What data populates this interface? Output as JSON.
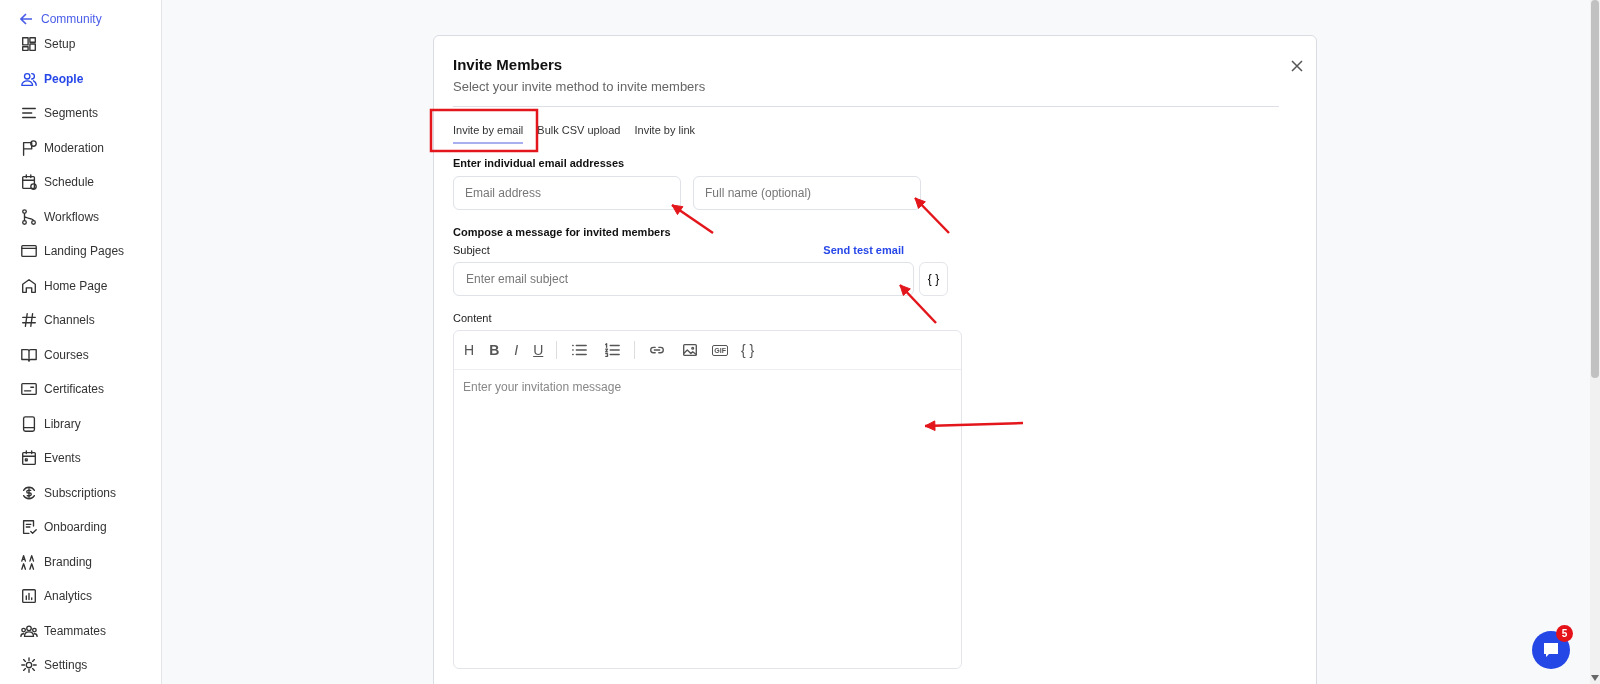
{
  "sidebar": {
    "back": {
      "label": "Community"
    },
    "items": [
      {
        "label": "Setup",
        "selected": false
      },
      {
        "label": "People",
        "selected": true
      },
      {
        "label": "Segments",
        "selected": false
      },
      {
        "label": "Moderation",
        "selected": false
      },
      {
        "label": "Schedule",
        "selected": false
      },
      {
        "label": "Workflows",
        "selected": false
      },
      {
        "label": "Landing Pages",
        "selected": false
      },
      {
        "label": "Home Page",
        "selected": false
      },
      {
        "label": "Channels",
        "selected": false
      },
      {
        "label": "Courses",
        "selected": false
      },
      {
        "label": "Certificates",
        "selected": false
      },
      {
        "label": "Library",
        "selected": false
      },
      {
        "label": "Events",
        "selected": false
      },
      {
        "label": "Subscriptions",
        "selected": false
      },
      {
        "label": "Onboarding",
        "selected": false
      },
      {
        "label": "Branding",
        "selected": false
      },
      {
        "label": "Analytics",
        "selected": false
      },
      {
        "label": "Teammates",
        "selected": false
      },
      {
        "label": "Settings",
        "selected": false
      }
    ]
  },
  "dialog": {
    "title": "Invite Members",
    "subtitle": "Select your invite method to invite members",
    "tabs": [
      {
        "label": "Invite by email",
        "selected": true
      },
      {
        "label": "Bulk CSV upload",
        "selected": false
      },
      {
        "label": "Invite by link",
        "selected": false
      }
    ],
    "email_section": {
      "heading": "Enter individual email addresses",
      "email": {
        "placeholder": "Email address"
      },
      "name": {
        "placeholder": "Full name (optional)"
      }
    },
    "compose_heading": "Compose a message for invited members",
    "subject": {
      "label": "Subject",
      "link": "Send test email",
      "placeholder": "Enter email subject",
      "variables_button": "{ }"
    },
    "content": {
      "label": "Content",
      "toolbar": [
        {
          "kind": "heading",
          "label": "H"
        },
        {
          "kind": "bold",
          "label": "B"
        },
        {
          "kind": "italic",
          "label": "I"
        },
        {
          "kind": "underline",
          "label": "U"
        },
        {
          "kind": "divider"
        },
        {
          "kind": "bullets"
        },
        {
          "kind": "numbers"
        },
        {
          "kind": "divider"
        },
        {
          "kind": "link"
        },
        {
          "kind": "image"
        },
        {
          "kind": "gif",
          "label": "GIF"
        },
        {
          "kind": "variables",
          "label": "{ }"
        }
      ],
      "placeholder": "Enter your invitation message"
    }
  },
  "chat": {
    "badge": "5"
  }
}
